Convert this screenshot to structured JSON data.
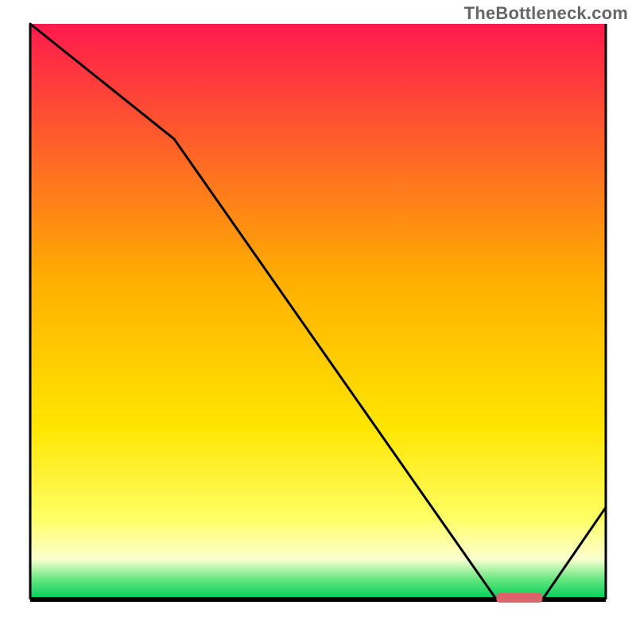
{
  "watermark": "TheBottleneck.com",
  "chart_data": {
    "type": "line",
    "title": "",
    "xlabel": "",
    "ylabel": "",
    "xlim": [
      0,
      100
    ],
    "ylim": [
      0,
      100
    ],
    "x": [
      0,
      25,
      81,
      89,
      100
    ],
    "values": [
      100,
      80,
      0,
      0,
      16
    ],
    "optimal_range": {
      "x_start": 81,
      "x_end": 89
    },
    "background": {
      "type": "vertical-gradient",
      "stops": [
        {
          "offset": 0.0,
          "color": "#ff1a4d"
        },
        {
          "offset": 0.45,
          "color": "#ffb000"
        },
        {
          "offset": 0.7,
          "color": "#ffe500"
        },
        {
          "offset": 0.86,
          "color": "#ffff66"
        },
        {
          "offset": 0.93,
          "color": "#fbffd0"
        },
        {
          "offset": 0.965,
          "color": "#66e680"
        },
        {
          "offset": 1.0,
          "color": "#00cc55"
        }
      ]
    },
    "marker_color": "#d9646b"
  }
}
